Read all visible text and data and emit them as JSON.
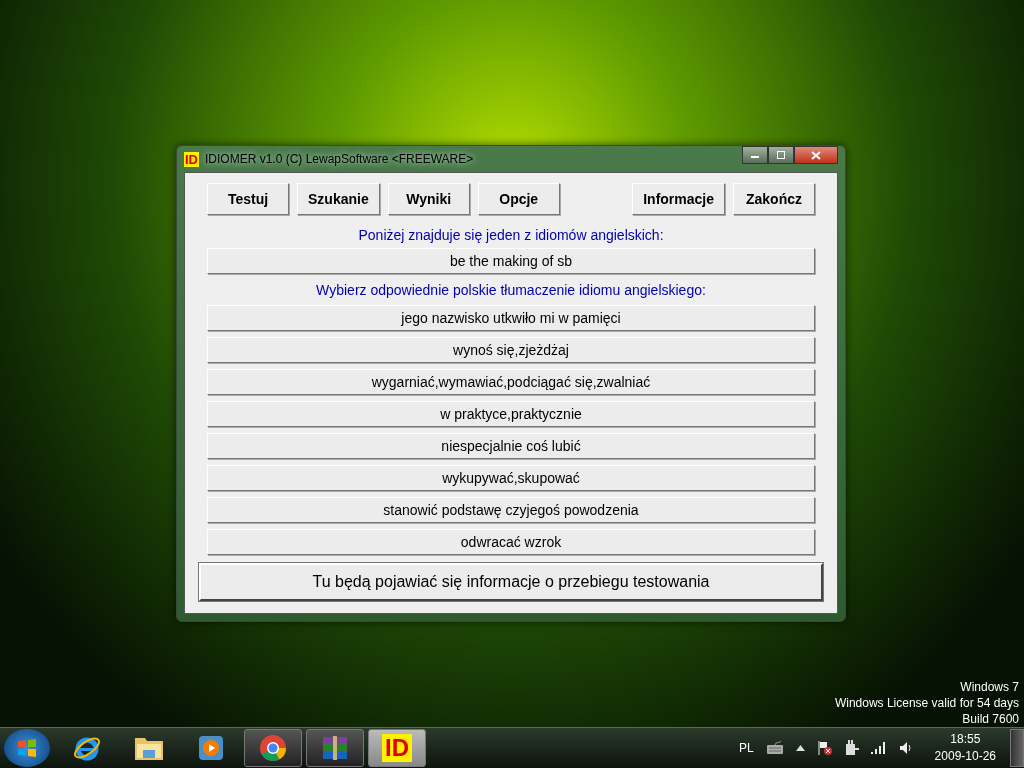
{
  "window": {
    "icon_text": "ID",
    "title": "IDIOMER v1.0 (C) LewapSoftware <FREEWARE>"
  },
  "toolbar": {
    "left": [
      "Testuj",
      "Szukanie",
      "Wyniki",
      "Opcje"
    ],
    "right": [
      "Informacje",
      "Zakończ"
    ]
  },
  "prompt": "Poniżej znajduje się jeden z idiomów angielskich:",
  "idiom": "be the making of sb",
  "question": "Wybierz odpowiednie polskie tłumaczenie idiomu angielskiego:",
  "answers": [
    "jego nazwisko utkwiło mi w pamięci",
    "wynoś się,zjeżdżaj",
    "wygarniać,wymawiać,podciągać się,zwalniać",
    "w praktyce,praktycznie",
    "niespecjalnie coś lubić",
    "wykupywać,skupować",
    "stanowić podstawę czyjegoś powodzenia",
    "odwracać wzrok"
  ],
  "status": "Tu będą pojawiać się informacje o przebiegu testowania",
  "desktop_notice": [
    "Windows 7",
    "Windows License valid for 54 days",
    "Build 7600"
  ],
  "taskbar": {
    "apps": [
      {
        "kind": "ie",
        "running": false,
        "selected": false
      },
      {
        "kind": "folder",
        "running": false,
        "selected": false
      },
      {
        "kind": "media",
        "running": false,
        "selected": false
      },
      {
        "kind": "chrome",
        "running": true,
        "selected": false
      },
      {
        "kind": "archive",
        "running": true,
        "selected": false
      },
      {
        "kind": "id",
        "running": true,
        "selected": true,
        "label": "ID"
      }
    ],
    "language": "PL",
    "time": "18:55",
    "date": "2009-10-26"
  }
}
